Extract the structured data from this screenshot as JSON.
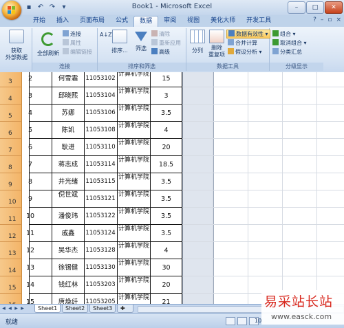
{
  "window": {
    "title": "Book1 - Microsoft Excel",
    "min": "–",
    "max": "□",
    "close": "✕"
  },
  "qat": [
    "save-icon",
    "undo-icon",
    "redo-icon"
  ],
  "tabs": [
    "开始",
    "插入",
    "页面布局",
    "公式",
    "数据",
    "审阅",
    "视图",
    "美化大师",
    "开发工具"
  ],
  "active_tab": "数据",
  "ribbon": {
    "get_external": "获取\n外部数据",
    "refresh_all": "全部刷新",
    "connections": "连接",
    "properties": "属性",
    "edit_links": "编辑链接",
    "group_connections": "连接",
    "sort_az": "A↓Z",
    "sort": "排序...",
    "filter": "筛选",
    "clear": "清除",
    "reapply": "重新应用",
    "advanced": "高级",
    "group_sort": "排序和筛选",
    "text_to_cols": "分列",
    "remove_dup": "删除\n重复项",
    "data_validation": "数据有效性",
    "consolidate": "合并计算",
    "whatif": "假设分析",
    "group_tools": "数据工具",
    "group": "组合",
    "ungroup": "取消组合",
    "subtotal": "分类汇总",
    "group_outline": "分级显示"
  },
  "rows": [
    {
      "row": "3",
      "n": "2",
      "name": "何雪霜",
      "id": "11053102",
      "dept": "计算机学院",
      "val": "15"
    },
    {
      "row": "4",
      "n": "3",
      "name": "邱晓熙",
      "id": "11053104",
      "dept": "计算机学院",
      "val": "3"
    },
    {
      "row": "5",
      "n": "4",
      "name": "苏娜",
      "id": "11053106",
      "dept": "计算机学院",
      "val": "3.5"
    },
    {
      "row": "6",
      "n": "5",
      "name": "陈凯",
      "id": "11053108",
      "dept": "计算机学院",
      "val": "4"
    },
    {
      "row": "7",
      "n": "6",
      "name": "耿进",
      "id": "11053110",
      "dept": "计算机学院",
      "val": "20"
    },
    {
      "row": "8",
      "n": "7",
      "name": "蒋志成",
      "id": "11053114",
      "dept": "计算机学院",
      "val": "18.5"
    },
    {
      "row": "9",
      "n": "8",
      "name": "井光绪",
      "id": "11053115",
      "dept": "计算机学院",
      "val": "3.5"
    },
    {
      "row": "10",
      "n": "9",
      "name": "倪世斌",
      "id": "11053121",
      "dept": "计算机学院",
      "val": "3.5"
    },
    {
      "row": "11",
      "n": "10",
      "name": "潘俊玮",
      "id": "11053122",
      "dept": "计算机学院",
      "val": "3.5"
    },
    {
      "row": "12",
      "n": "11",
      "name": "戚鑫",
      "id": "11053124",
      "dept": "计算机学院",
      "val": "3.5"
    },
    {
      "row": "13",
      "n": "12",
      "name": "吴华杰",
      "id": "11053128",
      "dept": "计算机学院",
      "val": "4"
    },
    {
      "row": "14",
      "n": "13",
      "name": "徐锡健",
      "id": "11053130",
      "dept": "计算机学院",
      "val": "30"
    },
    {
      "row": "15",
      "n": "14",
      "name": "钱红林",
      "id": "11053203",
      "dept": "计算机学院",
      "val": "20"
    },
    {
      "row": "16",
      "n": "15",
      "name": "唐焕纤",
      "id": "11053205",
      "dept": "计算机学院",
      "val": "21"
    }
  ],
  "sheets": [
    "Sheet1",
    "Sheet2",
    "Sheet3"
  ],
  "status": "就绪",
  "zoom": "10",
  "watermark": {
    "title": "易采站长站",
    "url": "www.easck.com"
  },
  "colors": {
    "row_header": "#f3b468",
    "accent": "#15428b",
    "ribbon": "#d6e3f3"
  }
}
